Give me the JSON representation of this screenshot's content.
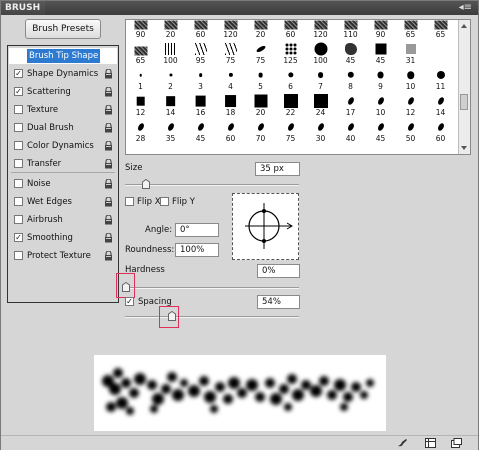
{
  "panel": {
    "title": "BRUSH",
    "menu_icon": "panel-menu-icon"
  },
  "presets_button": "Brush Presets",
  "sidebar": {
    "items": [
      {
        "label": "Brush Tip Shape",
        "checkbox": false,
        "checked": false,
        "lock": false,
        "selected": true
      },
      {
        "label": "Shape Dynamics",
        "checkbox": true,
        "checked": true,
        "lock": true
      },
      {
        "label": "Scattering",
        "checkbox": true,
        "checked": true,
        "lock": true
      },
      {
        "label": "Texture",
        "checkbox": true,
        "checked": false,
        "lock": true
      },
      {
        "label": "Dual Brush",
        "checkbox": true,
        "checked": false,
        "lock": true
      },
      {
        "label": "Color Dynamics",
        "checkbox": true,
        "checked": false,
        "lock": true
      },
      {
        "label": "Transfer",
        "checkbox": true,
        "checked": false,
        "lock": true
      },
      {
        "label": "Noise",
        "checkbox": true,
        "checked": false,
        "lock": true
      },
      {
        "label": "Wet Edges",
        "checkbox": true,
        "checked": false,
        "lock": true
      },
      {
        "label": "Airbrush",
        "checkbox": true,
        "checked": false,
        "lock": true
      },
      {
        "label": "Smoothing",
        "checkbox": true,
        "checked": true,
        "lock": true
      },
      {
        "label": "Protect Texture",
        "checkbox": true,
        "checked": false,
        "lock": true
      }
    ]
  },
  "brush_grid": {
    "rows": [
      [
        "90",
        "20",
        "60",
        "120",
        "20",
        "60",
        "120",
        "110",
        "90",
        "65",
        "65"
      ],
      [
        "65",
        "100",
        "95",
        "75",
        "75",
        "125",
        "100",
        "45",
        "45",
        "31"
      ],
      [
        "1",
        "2",
        "3",
        "4",
        "5",
        "6",
        "7",
        "8",
        "9",
        "10",
        "11"
      ],
      [
        "12",
        "14",
        "16",
        "18",
        "20",
        "22",
        "24",
        "17",
        "10",
        "12",
        "14"
      ],
      [
        "28",
        "35",
        "45",
        "60",
        "70",
        "75",
        "30",
        "40",
        "45",
        "50",
        "60"
      ]
    ]
  },
  "size": {
    "label": "Size",
    "value": "35 px",
    "slider": 0.12
  },
  "flip_x": {
    "label": "Flip X",
    "checked": false
  },
  "flip_y": {
    "label": "Flip Y",
    "checked": false
  },
  "angle": {
    "label": "Angle:",
    "value": "0°"
  },
  "roundness": {
    "label": "Roundness:",
    "value": "100%"
  },
  "hardness": {
    "label": "Hardness",
    "value": "0%",
    "slider": 0.0
  },
  "spacing": {
    "label": "Spacing",
    "checked": true,
    "value": "54%",
    "slider": 0.27
  },
  "bottom_icons": [
    "brush-toggle-icon",
    "grid-panel-icon",
    "new-preset-icon"
  ]
}
